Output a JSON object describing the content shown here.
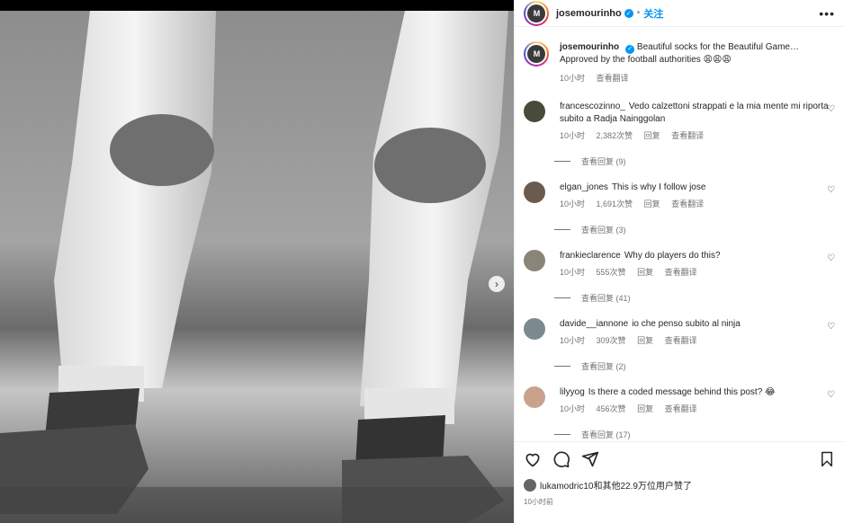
{
  "post": {
    "username": "josemourinho",
    "verified": true,
    "separator": "•",
    "follow_label": "关注",
    "more_label": "•••",
    "avatar_text": "M"
  },
  "caption": {
    "username": "josemourinho",
    "text": "Beautiful socks for the Beautiful Game… Approved by the football authorities",
    "emojis": "😩😩😩",
    "time": "10小时",
    "translate_label": "查看翻译"
  },
  "comments": [
    {
      "username": "francescozinno_",
      "text": "Vedo calzettoni strappati e la mia mente mi riporta subito a Radja Nainggolan",
      "time": "10小时",
      "likes": "2,382次赞",
      "reply_label": "回复",
      "translate_label": "查看翻译",
      "replies": "查看回复 (9)"
    },
    {
      "username": "elgan_jones",
      "text": "This is why I follow jose",
      "time": "10小时",
      "likes": "1,691次赞",
      "reply_label": "回复",
      "translate_label": "查看翻译",
      "replies": "查看回复 (3)"
    },
    {
      "username": "frankieclarence",
      "text": "Why do players do this?",
      "time": "10小时",
      "likes": "555次赞",
      "reply_label": "回复",
      "translate_label": "查看翻译",
      "replies": "查看回复 (41)"
    },
    {
      "username": "davide__iannone",
      "text": "io che penso subito al ninja",
      "time": "10小时",
      "likes": "309次赞",
      "reply_label": "回复",
      "translate_label": "查看翻译",
      "replies": "查看回复 (2)"
    },
    {
      "username": "lilyyog",
      "text": "Is there a coded message behind this post? 😂",
      "time": "10小时",
      "likes": "456次赞",
      "reply_label": "回复",
      "translate_label": "查看翻译",
      "replies": "查看回复 (17)"
    }
  ],
  "footer": {
    "likes_text": "lukamodric10和其他22.9万位用户赞了",
    "time": "10小时前"
  },
  "icons": {
    "heart": "heart-icon",
    "comment": "comment-icon",
    "share": "share-icon",
    "save": "bookmark-icon",
    "next": "chevron-right-icon"
  },
  "colors": {
    "accent": "#0095f6",
    "muted": "#737373"
  }
}
